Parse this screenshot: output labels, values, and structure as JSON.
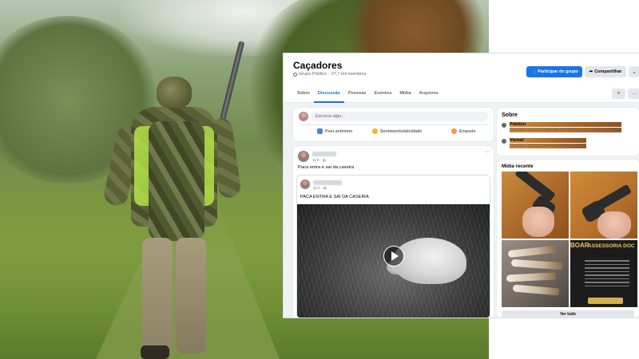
{
  "group": {
    "name": "Caçadores",
    "privacy": "Grupo Público",
    "members": "27,7 mil membros",
    "join_label": "Participar do grupo",
    "share_label": "Compartilhar",
    "more_label": "⌄"
  },
  "tabs": [
    {
      "label": "Sobre"
    },
    {
      "label": "Discussão"
    },
    {
      "label": "Pessoas"
    },
    {
      "label": "Eventos"
    },
    {
      "label": "Mídia"
    },
    {
      "label": "Arquivos"
    }
  ],
  "active_tab": "Discussão",
  "composer": {
    "placeholder": "Escreva algo...",
    "actions": [
      {
        "label": "Post anônimo",
        "icon": "anonymous-post-icon"
      },
      {
        "label": "Sentimento/atividade",
        "icon": "feeling-icon"
      },
      {
        "label": "Enquete",
        "icon": "poll-icon"
      }
    ]
  },
  "post": {
    "time": "11 h · ",
    "text": "Paca entra e sai da caseira",
    "shared": {
      "time": "11 h · ",
      "text": "PACA ENTRA E SAI DA CASEIRA"
    }
  },
  "about": {
    "heading": "Sobre",
    "public_title": "Público",
    "public_desc": "Qualquer pessoa pode ver os membros e os posts do grupo.",
    "visible_title": "Visível",
    "visible_desc": "Qualquer pessoa pode encontrar o grupo."
  },
  "media": {
    "heading": "Mídia recente",
    "ad_title": "ASSESSORIA DOC",
    "ad_logo": "BOAR",
    "see_all": "Ver tudo"
  },
  "colors": {
    "accent": "#1b74e4",
    "background": "#f0f2f5"
  }
}
